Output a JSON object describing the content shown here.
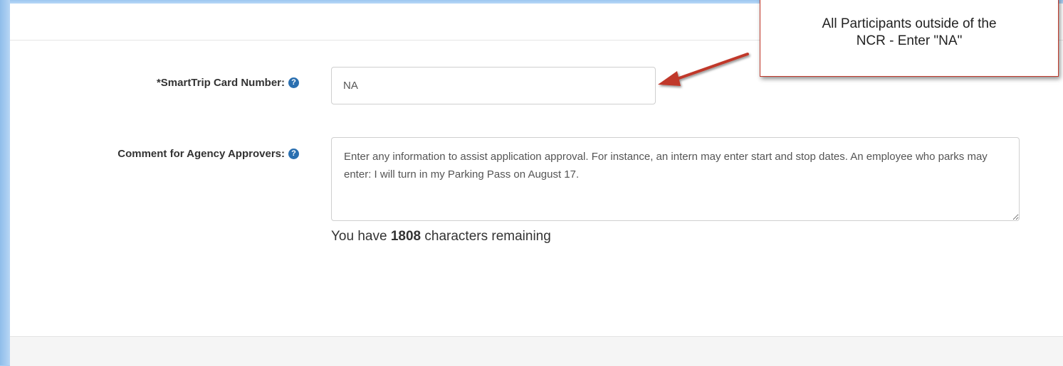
{
  "form": {
    "smarttrip": {
      "label": "*SmartTrip Card Number:",
      "help_glyph": "?",
      "value": "NA"
    },
    "comment": {
      "label": "Comment for Agency Approvers:",
      "help_glyph": "?",
      "value": "Enter any information to assist application approval. For instance, an intern may enter start and stop dates. An employee who parks may enter: I will turn in my Parking Pass on August 17."
    },
    "counter": {
      "prefix": "You have ",
      "count": "1808",
      "suffix": " characters remaining"
    }
  },
  "callout": {
    "text": "All Participants outside of the\nNCR - Enter \"NA\""
  },
  "colors": {
    "accent_blue": "#2a6fb0",
    "annotation_red": "#c0392b",
    "background_blue": "#a9cdf3"
  },
  "icons": {
    "help": "question-circle-icon",
    "annotation_arrow": "red-arrow-icon"
  }
}
